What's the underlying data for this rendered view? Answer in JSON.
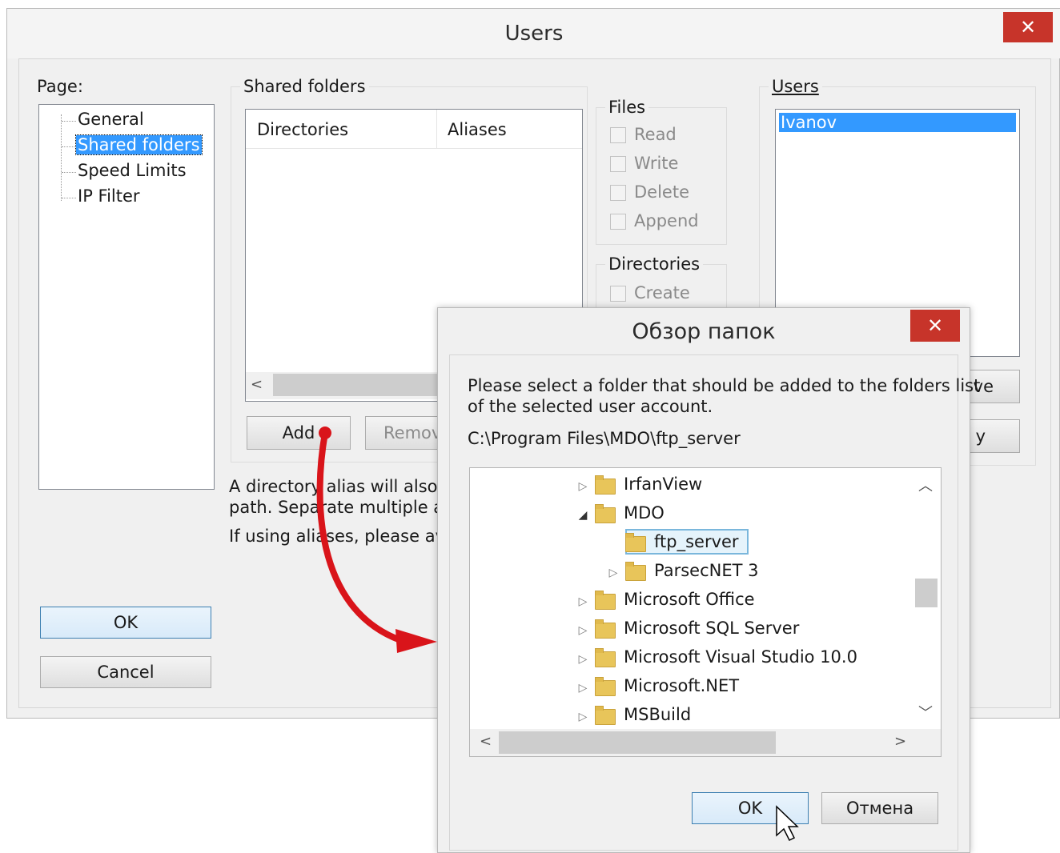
{
  "users_window": {
    "title": "Users",
    "close_glyph": "✕",
    "page_label": "Page:",
    "pages": [
      "General",
      "Shared folders",
      "Speed Limits",
      "IP Filter"
    ],
    "selected_page": "Shared folders",
    "shared_folders_legend": "Shared folders",
    "columns": [
      "Directories",
      "Aliases"
    ],
    "add_button": "Add",
    "remove_button_visible": "Remov",
    "files_legend": "Files",
    "files_permissions": [
      "Read",
      "Write",
      "Delete",
      "Append"
    ],
    "directories_legend": "Directories",
    "directories_permissions": [
      "Create"
    ],
    "users_legend": "Users",
    "users_list": [
      "Ivanov"
    ],
    "right_button_1_visible": "ve",
    "right_button_2_visible": "y",
    "info_line_1": "A directory alias will also app",
    "info_line_2": "path. Separate multiple alias",
    "info_line_3": "If using aliases, please avoi",
    "ok_button": "OK",
    "cancel_button": "Cancel"
  },
  "browse_dialog": {
    "title": "Обзор папок",
    "close_glyph": "✕",
    "description_line_1": "Please select a folder that should be added to the folders list",
    "description_line_2": "of the selected user account.",
    "current_path": "C:\\Program Files\\MDO\\ftp_server",
    "folders": [
      {
        "name": "IrfanView",
        "expander": "▷"
      },
      {
        "name": "MDO",
        "expander": "◢"
      },
      {
        "name": "ftp_server",
        "expander": ""
      },
      {
        "name": "ParsecNET 3",
        "expander": "▷"
      },
      {
        "name": "Microsoft Office",
        "expander": "▷"
      },
      {
        "name": "Microsoft SQL Server",
        "expander": "▷"
      },
      {
        "name": "Microsoft Visual Studio 10.0",
        "expander": "▷"
      },
      {
        "name": "Microsoft.NET",
        "expander": "▷"
      },
      {
        "name": "MSBuild",
        "expander": "▷"
      }
    ],
    "selected_folder": "ftp_server",
    "ok_button": "OK",
    "cancel_button": "Отмена"
  },
  "colors": {
    "selection": "#3399ff",
    "close_button": "#c7342a",
    "arrow": "#d9141a"
  }
}
